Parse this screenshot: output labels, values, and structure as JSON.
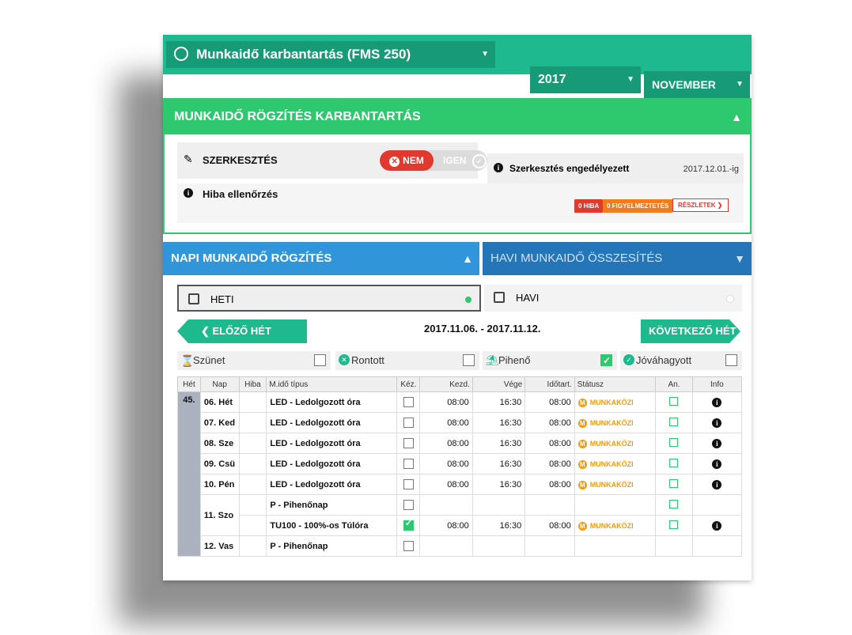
{
  "header": {
    "module_select": "Munkaidő karbantartás  (FMS 250)",
    "year_select": "2017",
    "month_select": "NOVEMBER"
  },
  "maintenance": {
    "title": "MUNKAIDŐ RÖGZÍTÉS KARBANTARTÁS",
    "edit_label": "SZERKESZTÉS",
    "toggle_no": "NEM",
    "toggle_yes": "IGEN",
    "edit_allowed_label": "Szerkesztés engedélyezett",
    "edit_allowed_date": "2017.12.01.-ig",
    "error_check_label": "Hiba ellenőrzés",
    "badge_errors": "0 HIBA",
    "badge_warnings": "0 FIGYELMEZTETÉS",
    "details_button": "RÉSZLETEK"
  },
  "tabs": {
    "daily": "NAPI MUNKAIDŐ RÖGZÍTÉS",
    "monthly": "HAVI MUNKAIDŐ ÖSSZESÍTÉS"
  },
  "view": {
    "weekly": "HETI",
    "monthly": "HAVI"
  },
  "navigation": {
    "prev": "ELŐZŐ HÉT",
    "range": "2017.11.06. - 2017.11.12.",
    "next": "KÖVETKEZŐ HÉT"
  },
  "legend": {
    "break": "Szünet",
    "spoiled": "Rontott",
    "rest": "Pihenő",
    "approved": "Jóváhagyott"
  },
  "table": {
    "headers": [
      "Hét",
      "Nap",
      "Hiba",
      "M.idő típus",
      "Kéz.",
      "Kezd.",
      "Vége",
      "Időtart.",
      "Státusz",
      "An.",
      "Info"
    ],
    "week": "45.",
    "rows": [
      {
        "day": "06. Hét",
        "type": "LED - Ledolgozott óra",
        "start": "08:00",
        "end": "16:30",
        "dur": "08:00",
        "status": "MUNKAKÖZI"
      },
      {
        "day": "07. Ked",
        "type": "LED - Ledolgozott óra",
        "start": "08:00",
        "end": "16:30",
        "dur": "08:00",
        "status": "MUNKAKÖZI"
      },
      {
        "day": "08. Sze",
        "type": "LED - Ledolgozott óra",
        "start": "08:00",
        "end": "16:30",
        "dur": "08:00",
        "status": "MUNKAKÖZI"
      },
      {
        "day": "09. Csü",
        "type": "LED - Ledolgozott óra",
        "start": "08:00",
        "end": "16:30",
        "dur": "08:00",
        "status": "MUNKAKÖZI"
      },
      {
        "day": "10. Pén",
        "type": "LED - Ledolgozott óra",
        "start": "08:00",
        "end": "16:30",
        "dur": "08:00",
        "status": "MUNKAKÖZI"
      },
      {
        "day": "11. Szo",
        "type": "P - Pihenőnap",
        "start": "",
        "end": "",
        "dur": "",
        "status": ""
      },
      {
        "day": "",
        "type": "TU100 - 100%-os Túlóra",
        "start": "08:00",
        "end": "16:30",
        "dur": "08:00",
        "status": "MUNKAKÖZI"
      },
      {
        "day": "12. Vas",
        "type": "P - Pihenőnap",
        "start": "",
        "end": "",
        "dur": "",
        "status": ""
      }
    ]
  },
  "colors": {
    "teal": "#1fb98e",
    "green": "#2ec86e",
    "blue": "#3096d9",
    "red": "#e2382e",
    "orange": "#f39c12"
  }
}
